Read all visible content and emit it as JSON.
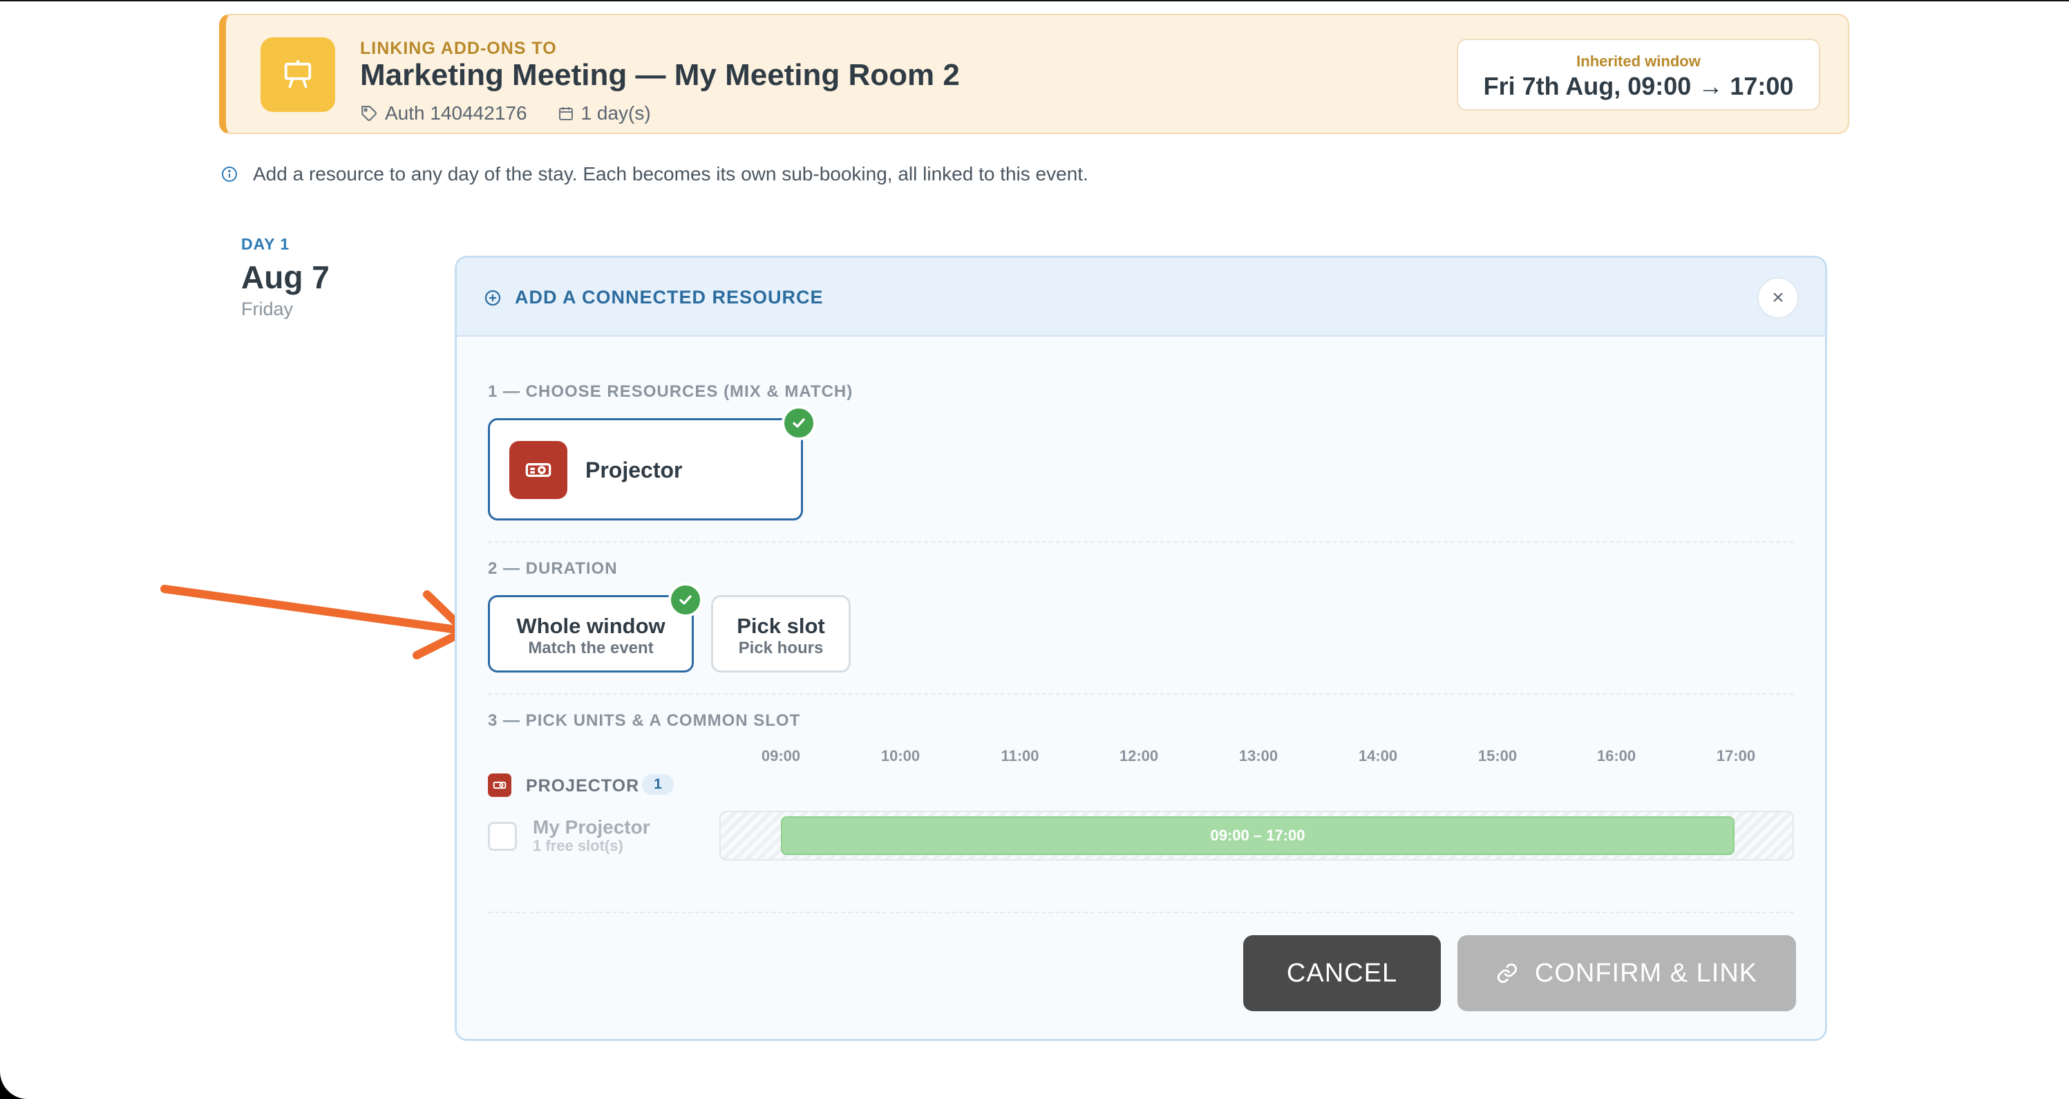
{
  "banner": {
    "eyebrow": "LINKING ADD-ONS TO",
    "title": "Marketing Meeting — My Meeting Room 2",
    "auth": "Auth 140442176",
    "days": "1 day(s)",
    "window_label": "Inherited window",
    "window_value": "Fri 7th Aug, 09:00 → 17:00",
    "icon": "presentation-board-icon"
  },
  "info_text": "Add a resource to any day of the stay. Each becomes its own sub-booking, all linked to this event.",
  "day": {
    "eyebrow": "DAY 1",
    "date": "Aug 7",
    "weekday": "Friday"
  },
  "panel": {
    "title": "ADD A CONNECTED RESOURCE",
    "close_label": "×",
    "section1": "1 — CHOOSE RESOURCES (MIX & MATCH)",
    "resource_label": "Projector",
    "section2": "2 — DURATION",
    "duration_options": [
      {
        "main": "Whole window",
        "sub": "Match the event",
        "selected": true
      },
      {
        "main": "Pick slot",
        "sub": "Pick hours",
        "selected": false
      }
    ],
    "section3": "3 — PICK UNITS & A COMMON SLOT",
    "hours": [
      "09:00",
      "10:00",
      "11:00",
      "12:00",
      "13:00",
      "14:00",
      "15:00",
      "16:00",
      "17:00"
    ],
    "group_name": "PROJECTOR",
    "group_count": "1",
    "unit_name": "My Projector",
    "unit_sub": "1 free slot(s)",
    "slot_label": "09:00 – 17:00",
    "cancel_label": "CANCEL",
    "confirm_label": "CONFIRM & LINK"
  },
  "colors": {
    "accent": "#2c6aa6",
    "banner_bg": "#fdf1df",
    "check": "#44a34f",
    "slot": "#a6dba6",
    "resource": "#b5392a",
    "arrow": "#ee6b2d"
  }
}
